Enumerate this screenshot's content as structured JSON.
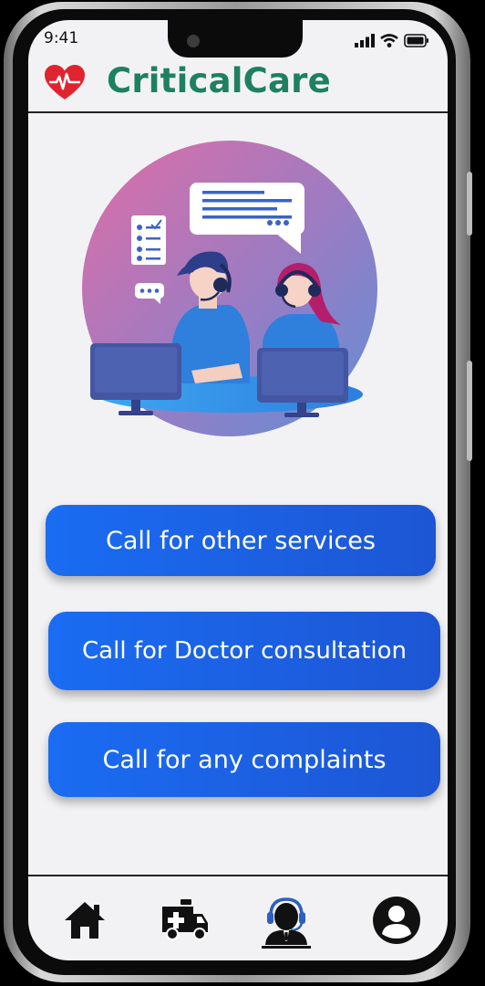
{
  "status_bar": {
    "time": "9:41"
  },
  "header": {
    "app_title": "CriticalCare",
    "logo_icon": "heart-pulse-icon"
  },
  "hero": {
    "illustration": "call-center-agents-illustration"
  },
  "actions": [
    {
      "label": "Call for other services"
    },
    {
      "label": "Call for Doctor consultation"
    },
    {
      "label": "Call for any complaints"
    }
  ],
  "nav": {
    "items": [
      {
        "icon": "home-icon"
      },
      {
        "icon": "ambulance-icon"
      },
      {
        "icon": "support-agent-icon",
        "active": true
      },
      {
        "icon": "profile-icon"
      }
    ]
  },
  "colors": {
    "brand_green": "#1e8060",
    "button_blue": "#1a6cf2",
    "heart_red": "#e0242f",
    "background": "#f2f2f4"
  }
}
